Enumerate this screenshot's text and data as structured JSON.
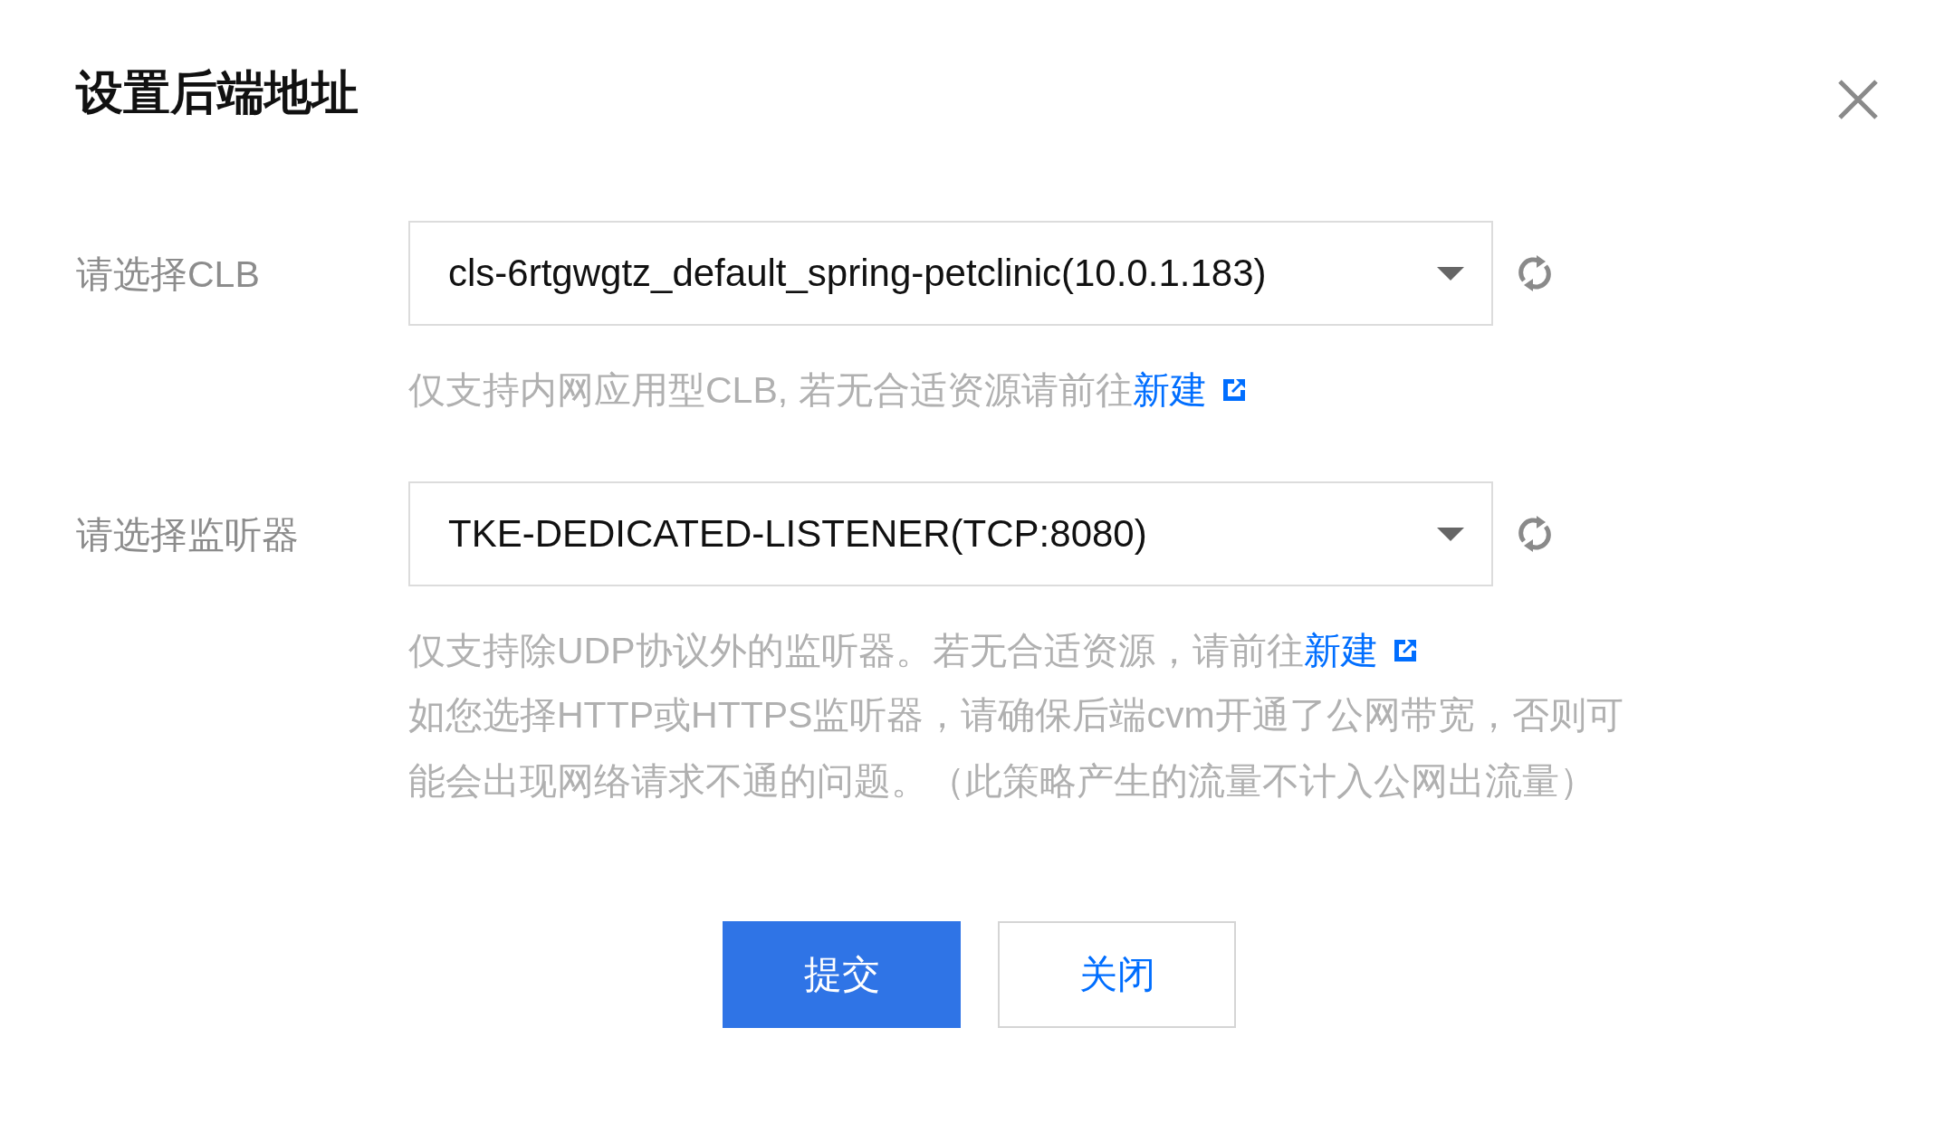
{
  "dialog": {
    "title": "设置后端地址"
  },
  "fields": [
    {
      "label": "请选择CLB",
      "value": "cls-6rtgwgtz_default_spring-petclinic(10.0.1.183)",
      "hint": {
        "text": "仅支持内网应用型CLB, 若无合适资源请前往",
        "link": "新建"
      }
    },
    {
      "label": "请选择监听器",
      "value": "TKE-DEDICATED-LISTENER(TCP:8080)",
      "hint": {
        "text": "仅支持除UDP协议外的监听器。若无合适资源，请前往",
        "link": "新建"
      },
      "note": "如您选择HTTP或HTTPS监听器，请确保后端cvm开通了公网带宽，否则可能会出现网络请求不通的问题。（此策略产生的流量不计入公网出流量）"
    }
  ],
  "buttons": [
    {
      "label": "提交",
      "kind": "primary"
    },
    {
      "label": "关闭",
      "kind": "secondary"
    }
  ]
}
